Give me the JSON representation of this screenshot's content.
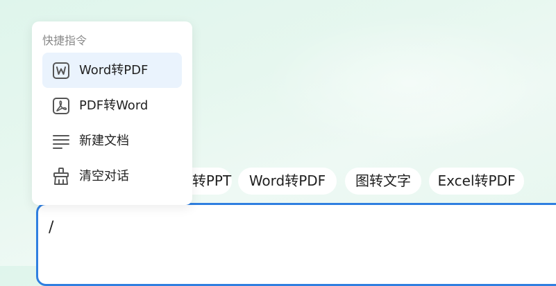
{
  "popup": {
    "title": "快捷指令",
    "items": [
      {
        "label": "Word转PDF",
        "icon": "word-icon",
        "active": true
      },
      {
        "label": "PDF转Word",
        "icon": "pdf-icon",
        "active": false
      },
      {
        "label": "新建文档",
        "icon": "new-document-icon",
        "active": false
      },
      {
        "label": "清空对话",
        "icon": "clear-conversation-icon",
        "active": false
      }
    ]
  },
  "chips": [
    {
      "label": "转PPT"
    },
    {
      "label": "Word转PDF"
    },
    {
      "label": "图转文字"
    },
    {
      "label": "Excel转PDF"
    }
  ],
  "input": {
    "value": "/"
  },
  "colors": {
    "accent": "#2f7fe0",
    "active_item_bg": "#eaf3fd",
    "background": "#e2f6ed"
  }
}
